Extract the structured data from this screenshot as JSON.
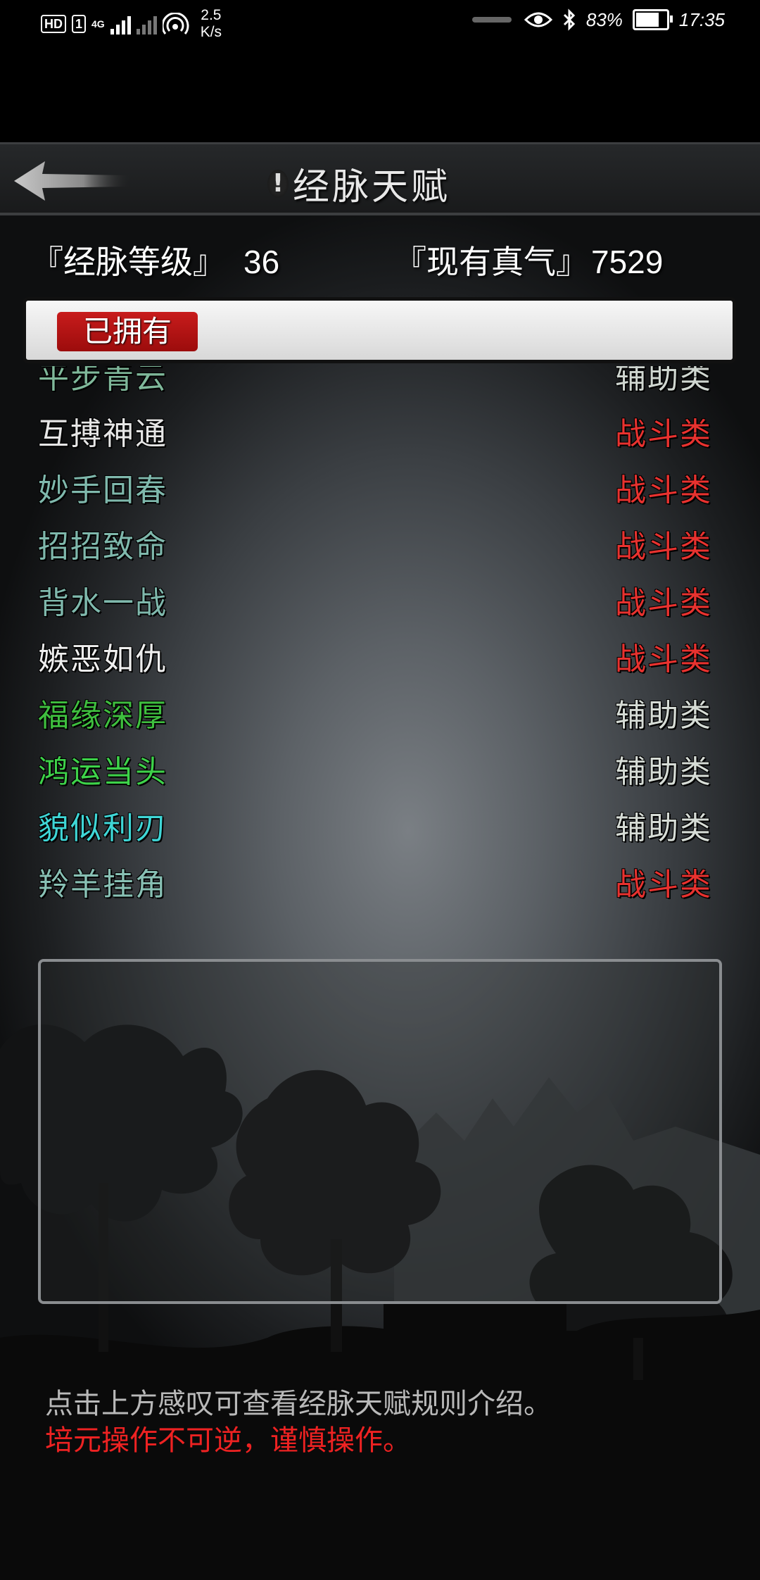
{
  "status_bar": {
    "hd": "HD",
    "sim": "1",
    "net": "4G",
    "speed_value": "2.5",
    "speed_unit": "K/s",
    "battery": "83%",
    "battery_level": 0.83,
    "time": "17:35"
  },
  "header": {
    "back_icon": "back-arrow-icon",
    "info_mark": "!",
    "title": "经脉天赋"
  },
  "stats": {
    "meridian_level_label": "『经脉等级』",
    "meridian_level_value": "36",
    "true_qi_label": "『现有真气』",
    "true_qi_value": "7529"
  },
  "tabs": {
    "owned_label": "已拥有"
  },
  "talents": [
    {
      "name": "平步青云",
      "category": "辅助类",
      "name_color": "#7fb89a",
      "category_color": "#cfd6d0"
    },
    {
      "name": "互搏神通",
      "category": "战斗类",
      "name_color": "#e6e6e6",
      "category_color": "#e8322f"
    },
    {
      "name": "妙手回春",
      "category": "战斗类",
      "name_color": "#7fb8ac",
      "category_color": "#e8322f"
    },
    {
      "name": "招招致命",
      "category": "战斗类",
      "name_color": "#7fb8ac",
      "category_color": "#e8322f"
    },
    {
      "name": "背水一战",
      "category": "战斗类",
      "name_color": "#7fb8ac",
      "category_color": "#e8322f"
    },
    {
      "name": "嫉恶如仇",
      "category": "战斗类",
      "name_color": "#eeeeee",
      "category_color": "#e8322f"
    },
    {
      "name": "福缘深厚",
      "category": "辅助类",
      "name_color": "#3fbf3f",
      "category_color": "#d6dcd6"
    },
    {
      "name": "鸿运当头",
      "category": "辅助类",
      "name_color": "#3ed24a",
      "category_color": "#d6dcd6"
    },
    {
      "name": "貌似利刃",
      "category": "辅助类",
      "name_color": "#3fd6d6",
      "category_color": "#d6dcd6"
    },
    {
      "name": "羚羊挂角",
      "category": "战斗类",
      "name_color": "#88c0b4",
      "category_color": "#e8322f"
    }
  ],
  "notes": {
    "line1": "点击上方感叹可查看经脉天赋规则介绍。",
    "line2": "培元操作不可逆，谨慎操作。"
  }
}
